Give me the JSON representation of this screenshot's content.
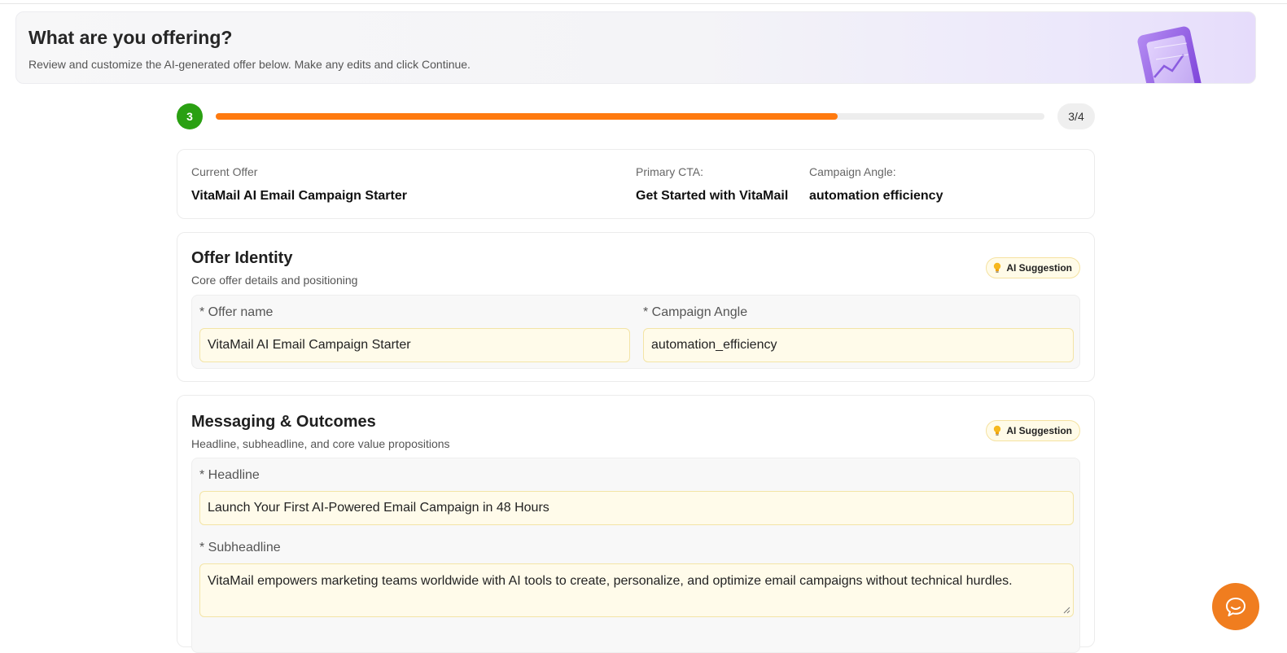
{
  "banner": {
    "title": "What are you offering?",
    "subtitle": "Review and customize the AI-generated offer below. Make any edits and click Continue."
  },
  "progress": {
    "step": "3",
    "count": "3/4",
    "fill_fraction": 0.75,
    "fill_color": "#ff7a0f",
    "step_color": "#2aa012"
  },
  "summary": {
    "current_offer_label": "Current Offer",
    "current_offer_value": "VitaMail AI Email Campaign Starter",
    "primary_cta_label": "Primary CTA:",
    "primary_cta_value": "Get Started with VitaMail",
    "campaign_angle_label": "Campaign Angle:",
    "campaign_angle_value": "automation efficiency"
  },
  "offer_identity": {
    "title": "Offer Identity",
    "subtitle": "Core offer details and positioning",
    "badge": "AI Suggestion",
    "offer_name_label": "* Offer name",
    "offer_name_value": "VitaMail AI Email Campaign Starter",
    "campaign_angle_label": "* Campaign Angle",
    "campaign_angle_value": "automation_efficiency"
  },
  "messaging": {
    "title": "Messaging & Outcomes",
    "subtitle": "Headline, subheadline, and core value propositions",
    "badge": "AI Suggestion",
    "headline_label": "* Headline",
    "headline_value": "Launch Your First AI-Powered Email Campaign in 48 Hours",
    "subheadline_label": "* Subheadline",
    "subheadline_value": "VitaMail empowers marketing teams worldwide with AI tools to create, personalize, and optimize email campaigns without technical hurdles."
  },
  "icons": {
    "badge_icon": "lightbulb-icon",
    "chat_icon": "chat-support-icon",
    "banner_art": "analytics-illustration"
  }
}
